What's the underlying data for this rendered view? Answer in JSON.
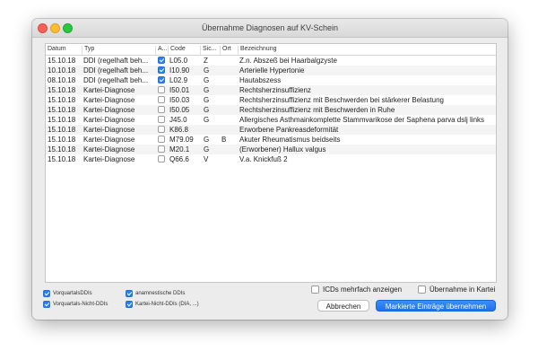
{
  "window": {
    "title": "Übernahme Diagnosen auf KV-Schein"
  },
  "table": {
    "columns": [
      "Datum",
      "Typ",
      "A...",
      "Code",
      "Sic...",
      "Ort",
      "Bezeichnung"
    ],
    "rows": [
      {
        "datum": "15.10.18",
        "typ": "DDI (regelhaft beh...",
        "checked": true,
        "code": "L05.0",
        "sic": "Z",
        "ort": "",
        "bez": "Z.n. Abszeß bei Haarbalgzyste"
      },
      {
        "datum": "10.10.18",
        "typ": "DDI (regelhaft beh...",
        "checked": true,
        "code": "I10.90",
        "sic": "G",
        "ort": "",
        "bez": "Arterielle Hypertonie"
      },
      {
        "datum": "08.10.18",
        "typ": "DDI (regelhaft beh...",
        "checked": true,
        "code": "L02.9",
        "sic": "G",
        "ort": "",
        "bez": "Hautabszess"
      },
      {
        "datum": "15.10.18",
        "typ": "Kartei-Diagnose",
        "checked": false,
        "code": "I50.01",
        "sic": "G",
        "ort": "",
        "bez": "Rechtsherzinsuffizienz"
      },
      {
        "datum": "15.10.18",
        "typ": "Kartei-Diagnose",
        "checked": false,
        "code": "I50.03",
        "sic": "G",
        "ort": "",
        "bez": "Rechtsherzinsuffizienz mit Beschwerden bei stärkerer Belastung"
      },
      {
        "datum": "15.10.18",
        "typ": "Kartei-Diagnose",
        "checked": false,
        "code": "I50.05",
        "sic": "G",
        "ort": "",
        "bez": "Rechtsherzinsuffizienz mit Beschwerden in Ruhe"
      },
      {
        "datum": "15.10.18",
        "typ": "Kartei-Diagnose",
        "checked": false,
        "code": "J45.0",
        "sic": "G",
        "ort": "",
        "bez": "Allergisches Asthmainkomplette Stammvarikose der Saphena parva dslj links"
      },
      {
        "datum": "15.10.18",
        "typ": "Kartei-Diagnose",
        "checked": false,
        "code": "K86.8",
        "sic": "",
        "ort": "",
        "bez": "Erworbene Pankreasdeformität"
      },
      {
        "datum": "15.10.18",
        "typ": "Kartei-Diagnose",
        "checked": false,
        "code": "M79.09",
        "sic": "G",
        "ort": "B",
        "bez": "Akuter Rheumatismus beidseits"
      },
      {
        "datum": "15.10.18",
        "typ": "Kartei-Diagnose",
        "checked": false,
        "code": "M20.1",
        "sic": "G",
        "ort": "",
        "bez": "(Erworbener) Hallux valgus"
      },
      {
        "datum": "15.10.18",
        "typ": "Kartei-Diagnose",
        "checked": false,
        "code": "Q66.6",
        "sic": "V",
        "ort": "",
        "bez": "V.a. Knickfuß 2"
      }
    ]
  },
  "filters": [
    {
      "label": "VorquartalsDDIs",
      "checked": true
    },
    {
      "label": "anamnestische DDIs",
      "checked": true
    },
    {
      "label": "Vorquartals-Nicht-DDIs",
      "checked": true
    },
    {
      "label": "Kartei-Nicht-DDIs (DIA, ...)",
      "checked": true
    }
  ],
  "options": {
    "icd_multiple": {
      "label": "ICDs mehrfach anzeigen",
      "checked": false
    },
    "take_into_kartei": {
      "label": "Übernahme in Kartei",
      "checked": false
    }
  },
  "buttons": {
    "cancel": "Abbrechen",
    "apply": "Markierte Einträge übernehmen"
  },
  "colors": {
    "accent": "#2a7ff6",
    "close": "#fc5f57",
    "minimize": "#fdbc2e",
    "maximize": "#28c840"
  }
}
